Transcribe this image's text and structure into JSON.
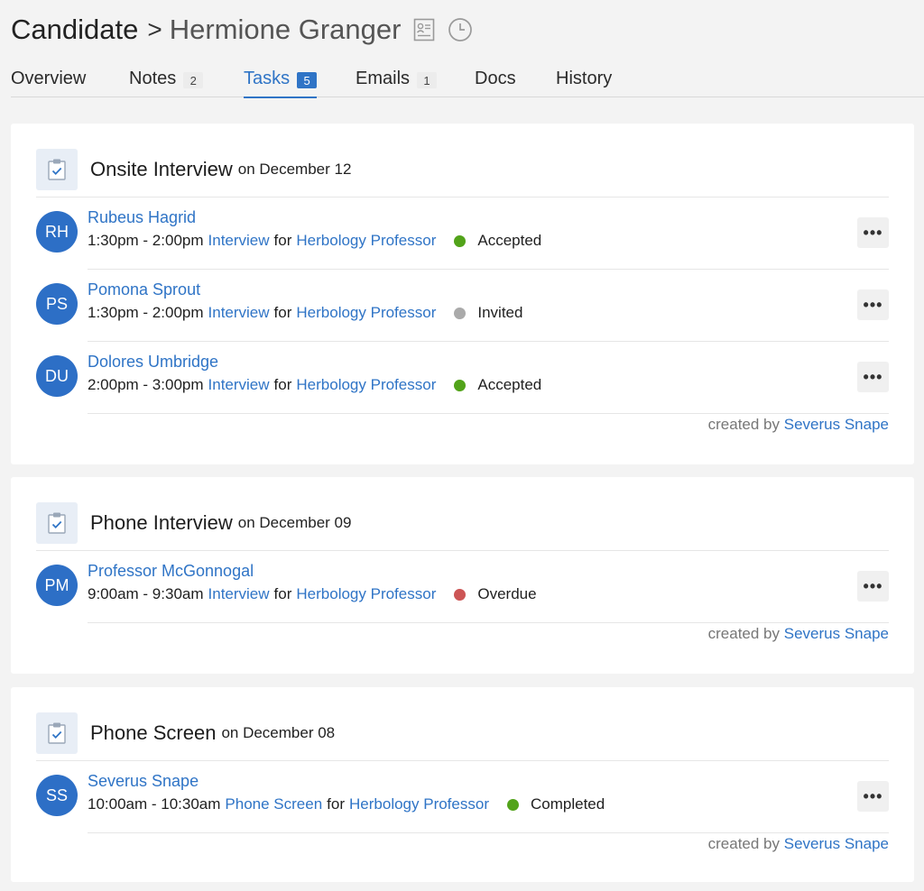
{
  "header": {
    "section": "Candidate",
    "separator": ">",
    "candidate_name": "Hermione Granger"
  },
  "tabs": [
    {
      "label": "Overview",
      "count": null
    },
    {
      "label": "Notes",
      "count": "2"
    },
    {
      "label": "Tasks",
      "count": "5"
    },
    {
      "label": "Emails",
      "count": "1"
    },
    {
      "label": "Docs",
      "count": null
    },
    {
      "label": "History",
      "count": null
    }
  ],
  "active_tab": "Tasks",
  "colors": {
    "accent": "#2f74c6",
    "avatar": "#2d6fc6",
    "status_accepted": "#52a31a",
    "status_invited": "#aaaaaa",
    "status_overdue": "#cc5555",
    "status_completed": "#52a31a"
  },
  "tasks": [
    {
      "title": "Onsite Interview",
      "date": "on December 12",
      "rows": [
        {
          "initials": "RH",
          "name": "Rubeus Hagrid",
          "time": "1:30pm - 2:00pm",
          "type": "Interview",
          "for": "for",
          "job": "Herbology Professor",
          "status": "Accepted",
          "status_color": "#52a31a"
        },
        {
          "initials": "PS",
          "name": "Pomona Sprout",
          "time": "1:30pm - 2:00pm",
          "type": "Interview",
          "for": "for",
          "job": "Herbology Professor",
          "status": "Invited",
          "status_color": "#aaaaaa"
        },
        {
          "initials": "DU",
          "name": "Dolores Umbridge",
          "time": "2:00pm - 3:00pm",
          "type": "Interview",
          "for": "for",
          "job": "Herbology Professor",
          "status": "Accepted",
          "status_color": "#52a31a"
        }
      ],
      "created_by_label": "created by",
      "created_by": "Severus Snape"
    },
    {
      "title": "Phone Interview",
      "date": "on December 09",
      "rows": [
        {
          "initials": "PM",
          "name": "Professor McGonnogal",
          "time": "9:00am - 9:30am",
          "type": "Interview",
          "for": "for",
          "job": "Herbology Professor",
          "status": "Overdue",
          "status_color": "#cc5555"
        }
      ],
      "created_by_label": "created by",
      "created_by": "Severus Snape"
    },
    {
      "title": "Phone Screen",
      "date": "on December 08",
      "rows": [
        {
          "initials": "SS",
          "name": "Severus Snape",
          "time": "10:00am - 10:30am",
          "type": "Phone Screen",
          "for": "for",
          "job": "Herbology Professor",
          "status": "Completed",
          "status_color": "#52a31a"
        }
      ],
      "created_by_label": "created by",
      "created_by": "Severus Snape"
    }
  ],
  "icons": {
    "profile": "id-card-icon",
    "history": "clock-icon",
    "task": "clipboard-check-icon",
    "more": "more-horizontal-icon"
  },
  "more_label": "•••"
}
